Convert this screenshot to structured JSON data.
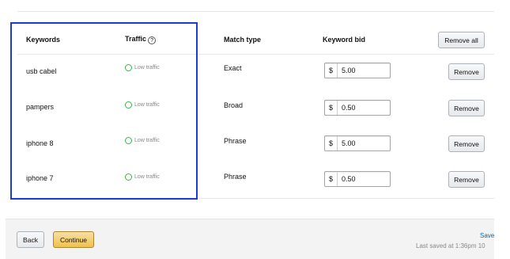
{
  "table": {
    "headers": {
      "keywords": "Keywords",
      "traffic": "Traffic",
      "traffic_help_icon": "?",
      "match_type": "Match type",
      "keyword_bid": "Keyword bid"
    },
    "remove_all_label": "Remove all",
    "rows": [
      {
        "keyword": "usb cabel",
        "traffic": "Low traffic",
        "match_type": "Exact",
        "currency": "$",
        "bid": "5.00",
        "remove_label": "Remove"
      },
      {
        "keyword": "pampers",
        "traffic": "Low traffic",
        "match_type": "Broad",
        "currency": "$",
        "bid": "0.50",
        "remove_label": "Remove"
      },
      {
        "keyword": "iphone 8",
        "traffic": "Low traffic",
        "match_type": "Phrase",
        "currency": "$",
        "bid": "5.00",
        "remove_label": "Remove"
      },
      {
        "keyword": "iphone 7",
        "traffic": "Low traffic",
        "match_type": "Phrase",
        "currency": "$",
        "bid": "0.50",
        "remove_label": "Remove"
      }
    ]
  },
  "footer": {
    "back_label": "Back",
    "continue_label": "Continue",
    "save_link": "Save",
    "last_saved": "Last saved at 1:36pm 10"
  },
  "colors": {
    "highlight": "#1a3bd4",
    "traffic_ok": "#39b54a",
    "primary_button": "#f0c14b",
    "link": "#0066c0"
  },
  "icons": {
    "traffic_status": "circle-outline-icon",
    "help": "question-circle-icon"
  }
}
